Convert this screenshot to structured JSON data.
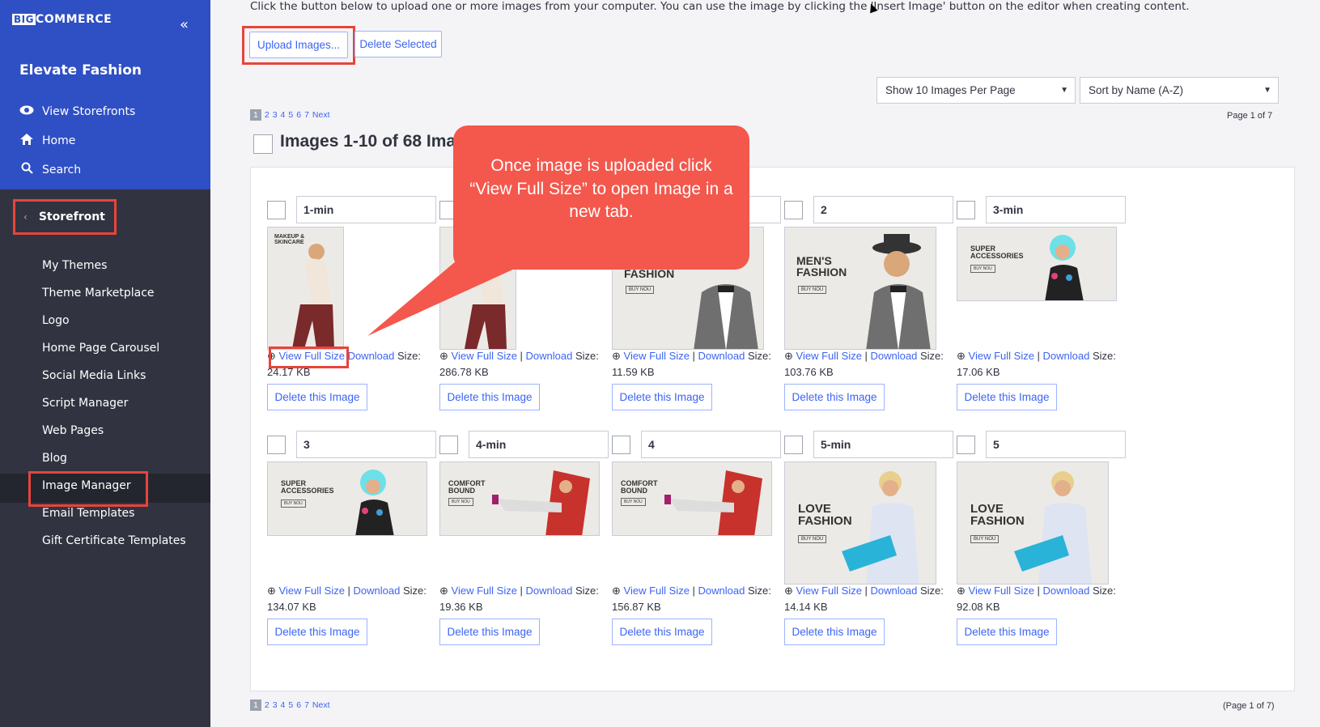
{
  "brand": {
    "logo_badge": "BIG",
    "logo_text": "COMMERCE",
    "store_name": "Elevate Fashion"
  },
  "sidebar": {
    "top_items": [
      {
        "label": "View Storefronts",
        "icon": "eye-icon"
      },
      {
        "label": "Home",
        "icon": "home-icon"
      },
      {
        "label": "Search",
        "icon": "search-icon"
      }
    ],
    "section": "Storefront",
    "sub_items": [
      "My Themes",
      "Theme Marketplace",
      "Logo",
      "Home Page Carousel",
      "Social Media Links",
      "Script Manager",
      "Web Pages",
      "Blog",
      "Image Manager",
      "Email Templates",
      "Gift Certificate Templates"
    ],
    "active": "Image Manager"
  },
  "main": {
    "intro": "Click the button below to upload one or more images from your computer. You can use the image by clicking the 'Insert Image' button on the editor when creating content.",
    "upload_label": "Upload Images...",
    "delete_selected_label": "Delete Selected",
    "per_page_select": "Show 10 Images Per Page",
    "sort_select": "Sort by Name (A-Z)",
    "pager": {
      "current": "1",
      "pages": [
        "2",
        "3",
        "4",
        "5",
        "6",
        "7"
      ],
      "next": "Next"
    },
    "page_of_top": "Page 1 of 7",
    "page_of_bottom": "(Page 1 of 7)",
    "heading": "Images 1-10 of 68 Ima",
    "view_label": "View Full Size",
    "download_label": "Download",
    "size_label": "Size:",
    "delete_label": "Delete this Image"
  },
  "images": [
    {
      "name": "1-min",
      "size": "24.17 KB",
      "art": "MAKEUP & SKINCARE"
    },
    {
      "name": "",
      "size": "286.78 KB",
      "art": ""
    },
    {
      "name": "",
      "size": "11.59 KB",
      "art": "FASHION"
    },
    {
      "name": "2",
      "size": "103.76 KB",
      "art": "MEN'S FASHION"
    },
    {
      "name": "3-min",
      "size": "17.06 KB",
      "art": "SUPER ACCESSORIES"
    },
    {
      "name": "3",
      "size": "134.07 KB",
      "art": "SUPER ACCESSORIES"
    },
    {
      "name": "4-min",
      "size": "19.36 KB",
      "art": "COMFORT BOUND"
    },
    {
      "name": "4",
      "size": "156.87 KB",
      "art": "COMFORT BOUND"
    },
    {
      "name": "5-min",
      "size": "14.14 KB",
      "art": "LOVE FASHION"
    },
    {
      "name": "5",
      "size": "92.08 KB",
      "art": "LOVE FASHION"
    }
  ],
  "thumb_button": "BUY NOU",
  "callout": {
    "text": "Once image is uploaded click “View Full Size” to open Image in a new tab."
  },
  "colors": {
    "sidebar_top": "#2f4fc4",
    "sidebar": "#313440",
    "accent": "#3c64f4",
    "highlight": "#e8443a",
    "callout": "#f4574c"
  }
}
